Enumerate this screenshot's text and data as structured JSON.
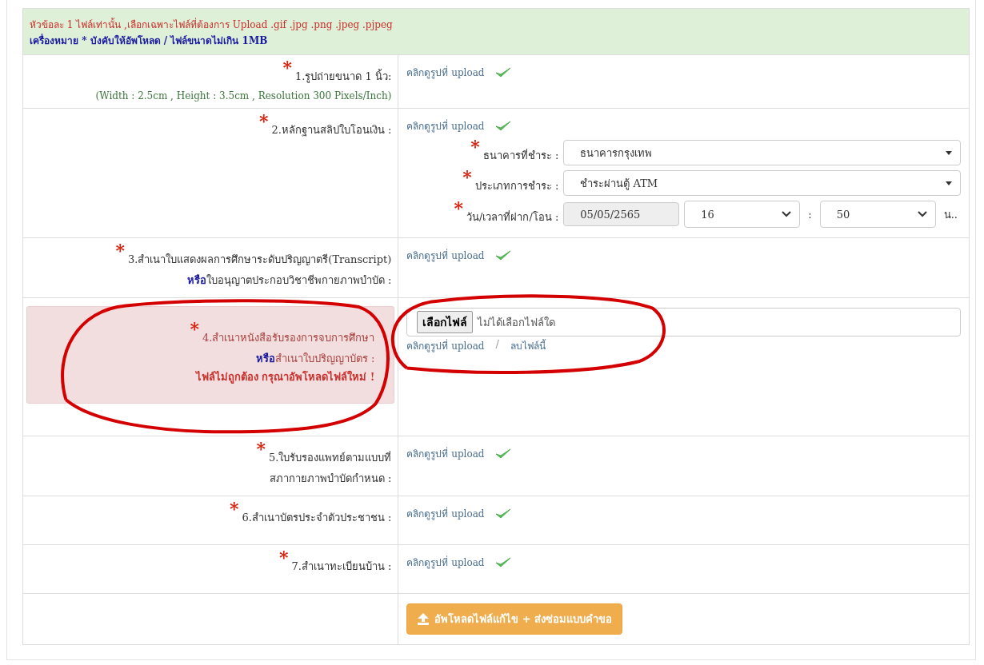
{
  "notice": {
    "text": "หัวข้อละ 1 ไฟล์เท่านั้น ,เลือกเฉพาะไฟล์ที่ต้องการ Upload .gif .jpg .png .jpeg .pjpeg",
    "requirement": "เครื่องหมาย * บังคับให้อัพโหลด / ไฟล์ขนาดไม่เกิน 1MB"
  },
  "documents": [
    {
      "kind": "uploaded",
      "required_mark": "*",
      "label_lines": [
        "1.รูปถ่ายขนาด 1 นิ้ว:"
      ],
      "note": "(Width : 2.5cm , Height : 3.5cm , Resolution 300 Pixels/Inch)",
      "view_link": "คลิกดูรูปที่ upload",
      "verified": true
    },
    {
      "kind": "payment",
      "required_mark": "*",
      "label_lines": [
        "2.หลักฐานสลิปใบโอนเงิน :"
      ],
      "view_link": "คลิกดูรูปที่ upload",
      "verified": true,
      "payment": {
        "bank_mark": "*",
        "bank_label": "ธนาคารที่ชำระ :",
        "bank": "ธนาคารกรุงเทพ",
        "type_mark": "*",
        "type_label": "ประเภทการชำระ :",
        "type": "ชำระผ่านตู้ ATM",
        "datetime_mark": "*",
        "datetime_label": "วัน/เวลาที่ฝาก/โอน :",
        "date": "05/05/2565",
        "hour": "16",
        "separator": ":",
        "minute": "50",
        "unit": "น.."
      }
    },
    {
      "kind": "uploaded",
      "required_mark": "*",
      "label_lines": [
        "3.สำเนาใบแสดงผลการศึกษาระดับปริญญาตรี(Transcript)",
        "**หรือ**ใบอนุญาตประกอบวิชาชีพกายภาพบำบัด :"
      ],
      "view_link": "คลิกดูรูปที่ upload",
      "verified": true
    },
    {
      "kind": "invalid",
      "required_mark": "*",
      "label_lines": [
        "4.สำเนาหนังสือรับรองการจบการศึกษา",
        "**หรือ**สำเนาใบปริญญาบัตร :"
      ],
      "error": "ไฟล์ไม่ถูกต้อง กรุณาอัพโหลดไฟล์ใหม่ !",
      "file_button": "เลือกไฟล์",
      "file_status": "ไม่ได้เลือกไฟล์ใด",
      "view_link": "คลิกดูรูปที่ upload",
      "link_separator": "/",
      "delete_link": "ลบไฟล์นี้"
    },
    {
      "kind": "uploaded",
      "required_mark": "*",
      "label_lines": [
        "5.ใบรับรองแพทย์ตามแบบที่",
        "สภากายภาพบำบัดกำหนด :"
      ],
      "view_link": "คลิกดูรูปที่ upload",
      "verified": true
    },
    {
      "kind": "uploaded",
      "required_mark": "*",
      "label_lines": [
        "6.สำเนาบัตรประจำตัวประชาชน :"
      ],
      "view_link": "คลิกดูรูปที่ upload",
      "verified": true
    },
    {
      "kind": "uploaded",
      "required_mark": "*",
      "label_lines": [
        "7.สำเนาทะเบียนบ้าน :"
      ],
      "view_link": "คลิกดูรูปที่ upload",
      "verified": true
    }
  ],
  "submit_button": "อัพโหลดไฟล์แก้ไข + ส่งซ่อมแบบคำขอ"
}
